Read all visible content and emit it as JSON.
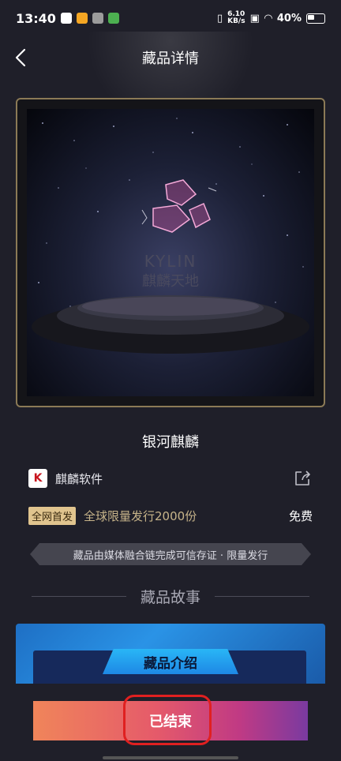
{
  "status_bar": {
    "time": "13:40",
    "net_speed_value": "6.10",
    "net_speed_unit": "KB/s",
    "battery": "40%"
  },
  "header": {
    "title": "藏品详情"
  },
  "nft": {
    "name": "银河麒麟",
    "creator": "麒麟软件",
    "creator_logo_letter": "K",
    "first_release_badge": "全网首发",
    "limit_text": "全球限量发行2000份",
    "price": "免费",
    "chain_notice": "藏品由媒体融合链完成可信存证 · 限量发行"
  },
  "story": {
    "section_title": "藏品故事",
    "card_title": "藏品介绍"
  },
  "action": {
    "button_label": "已结束"
  },
  "colors": {
    "accent_gold": "#e0c48e",
    "highlight_red": "#e02020",
    "button_gradient_start": "#f0855a",
    "button_gradient_end": "#7a3aa0"
  },
  "icons": {
    "back": "chevron-left-icon",
    "share": "share-icon"
  }
}
